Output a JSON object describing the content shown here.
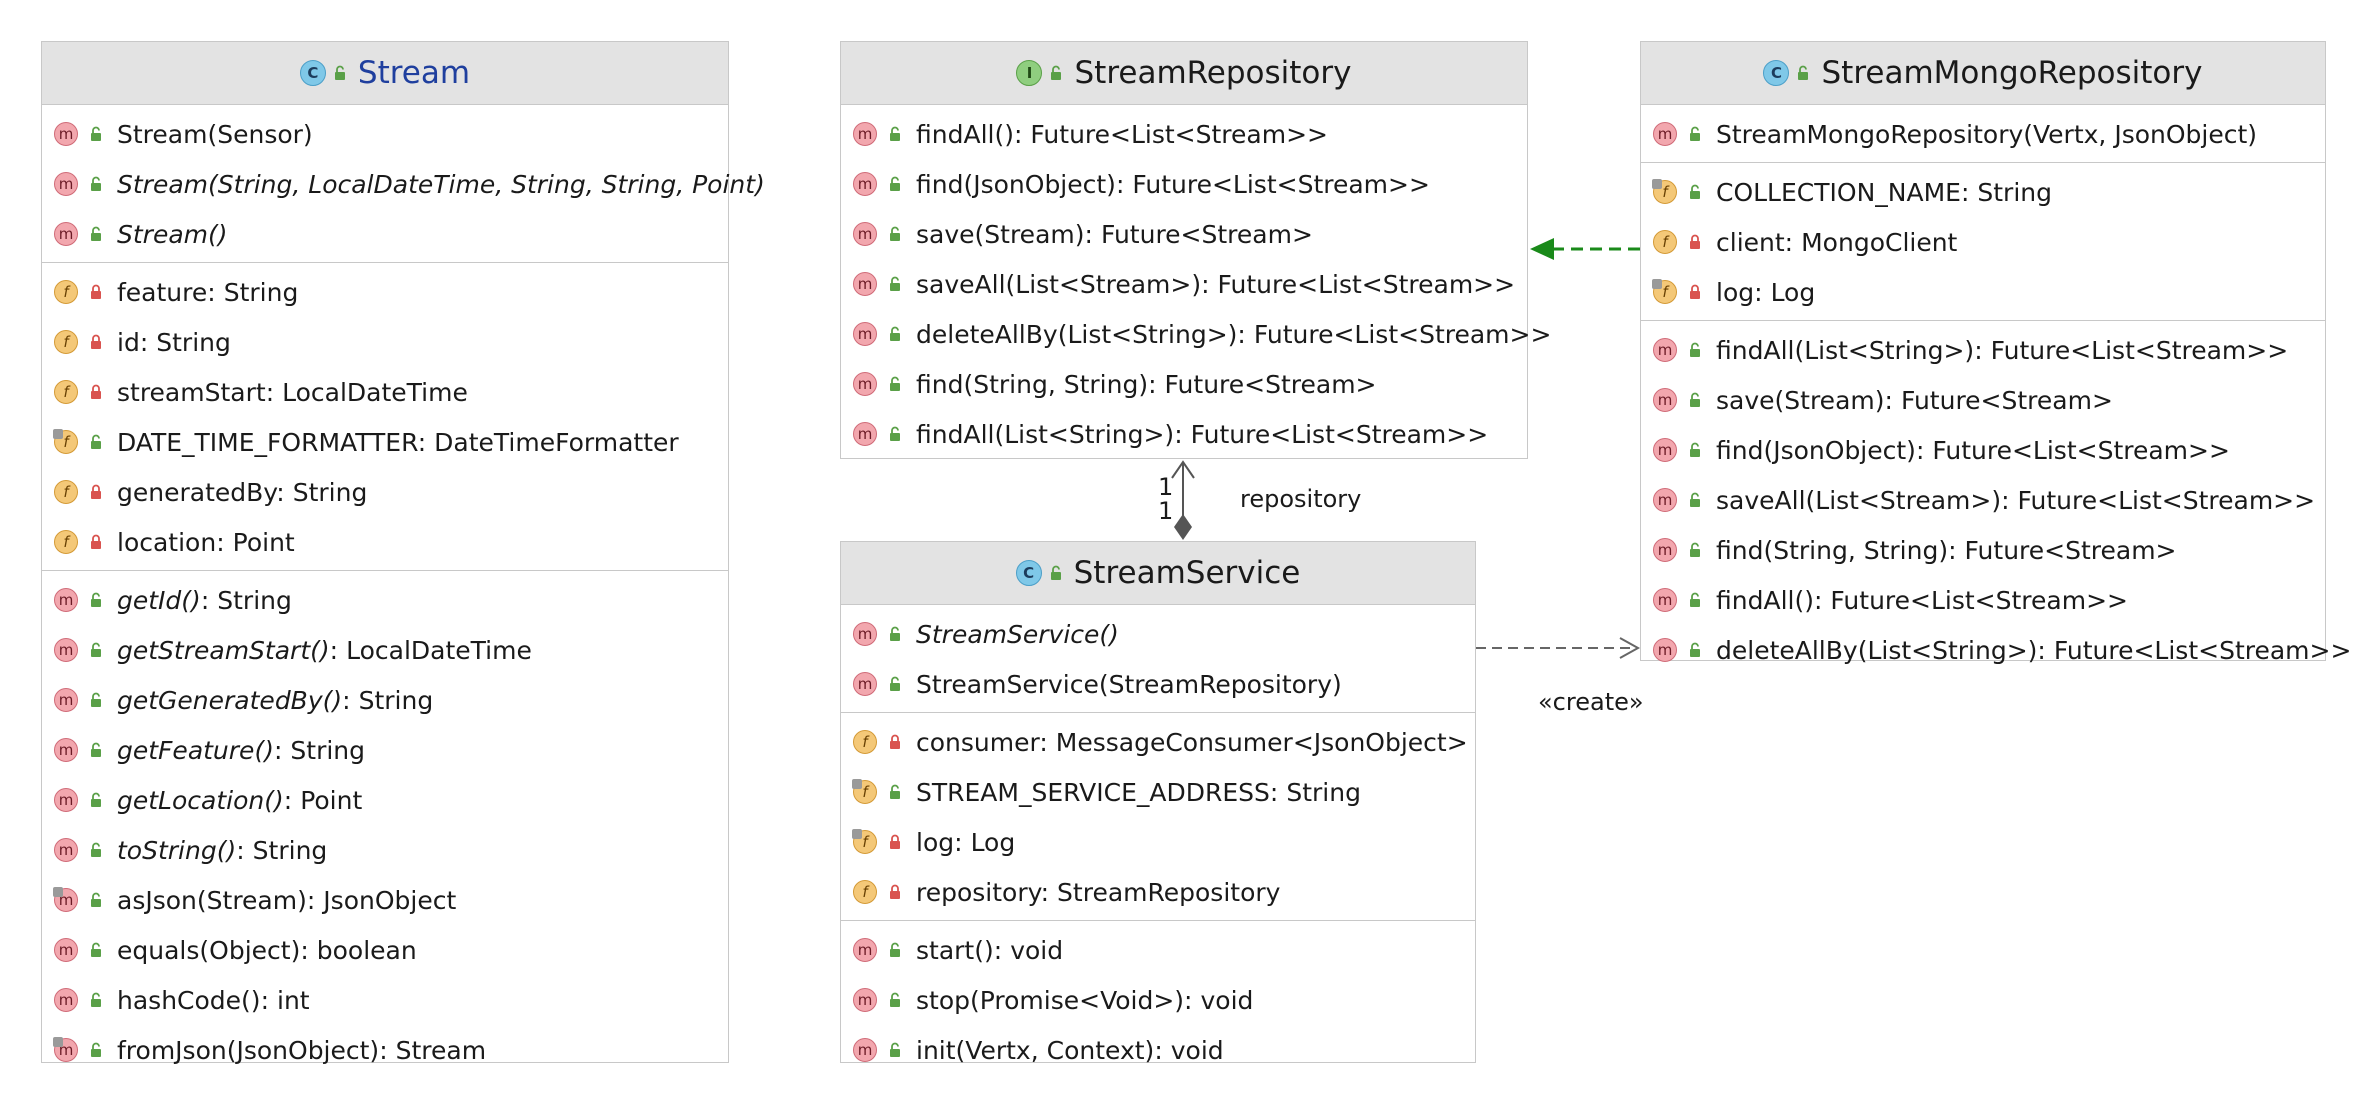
{
  "colors": {
    "header_bg": "#e3e3e3",
    "border": "#c8c8c8",
    "stream_title": "#1f3f9e",
    "implements_arrow": "#1a8a1a",
    "dependency_arrow": "#666666",
    "composition": "#555555"
  },
  "classes": {
    "stream": {
      "kind_icon": "C",
      "title": "Stream",
      "constructors": [
        {
          "name": "Stream",
          "params": "(Sensor)",
          "ret": "",
          "italic": false
        },
        {
          "name": "Stream",
          "params": "(String, LocalDateTime, String, String, Point)",
          "ret": "",
          "italic": true
        },
        {
          "name": "Stream",
          "params": "()",
          "ret": "",
          "italic": true
        }
      ],
      "fields": [
        {
          "name": "feature",
          "type": "String",
          "private": true,
          "static": false
        },
        {
          "name": "id",
          "type": "String",
          "private": true,
          "static": false
        },
        {
          "name": "streamStart",
          "type": "LocalDateTime",
          "private": true,
          "static": false
        },
        {
          "name": "DATE_TIME_FORMATTER",
          "type": "DateTimeFormatter",
          "private": false,
          "static": true
        },
        {
          "name": "generatedBy",
          "type": "String",
          "private": true,
          "static": false
        },
        {
          "name": "location",
          "type": "Point",
          "private": true,
          "static": false
        }
      ],
      "methods": [
        {
          "name": "getId",
          "params": "()",
          "ret": "String",
          "italic": true
        },
        {
          "name": "getStreamStart",
          "params": "()",
          "ret": "LocalDateTime",
          "italic": true
        },
        {
          "name": "getGeneratedBy",
          "params": "()",
          "ret": "String",
          "italic": true
        },
        {
          "name": "getFeature",
          "params": "()",
          "ret": "String",
          "italic": true
        },
        {
          "name": "getLocation",
          "params": "()",
          "ret": "Point",
          "italic": true
        },
        {
          "name": "toString",
          "params": "()",
          "ret": "String",
          "italic": true
        },
        {
          "name": "asJson",
          "params": "(Stream)",
          "ret": "JsonObject",
          "italic": false,
          "static": true
        },
        {
          "name": "equals",
          "params": "(Object)",
          "ret": "boolean",
          "italic": false
        },
        {
          "name": "hashCode",
          "params": "()",
          "ret": "int",
          "italic": false
        },
        {
          "name": "fromJson",
          "params": "(JsonObject)",
          "ret": "Stream",
          "italic": false,
          "static": true
        }
      ]
    },
    "stream_repository": {
      "kind_icon": "I",
      "title": "StreamRepository",
      "methods": [
        {
          "name": "findAll",
          "params": "()",
          "ret": "Future<List<Stream>>"
        },
        {
          "name": "find",
          "params": "(JsonObject)",
          "ret": "Future<List<Stream>>"
        },
        {
          "name": "save",
          "params": "(Stream)",
          "ret": "Future<Stream>"
        },
        {
          "name": "saveAll",
          "params": "(List<Stream>)",
          "ret": "Future<List<Stream>>"
        },
        {
          "name": "deleteAllBy",
          "params": "(List<String>)",
          "ret": "Future<List<Stream>>"
        },
        {
          "name": "find",
          "params": "(String, String)",
          "ret": "Future<Stream>"
        },
        {
          "name": "findAll",
          "params": "(List<String>)",
          "ret": "Future<List<Stream>>"
        }
      ]
    },
    "stream_mongo_repository": {
      "kind_icon": "C",
      "title": "StreamMongoRepository",
      "constructors": [
        {
          "name": "StreamMongoRepository",
          "params": "(Vertx, JsonObject)",
          "ret": ""
        }
      ],
      "fields": [
        {
          "name": "COLLECTION_NAME",
          "type": "String",
          "private": false,
          "static": true
        },
        {
          "name": "client",
          "type": "MongoClient",
          "private": true,
          "static": false
        },
        {
          "name": "log",
          "type": "Log",
          "private": true,
          "static": true
        }
      ],
      "methods": [
        {
          "name": "findAll",
          "params": "(List<String>)",
          "ret": "Future<List<Stream>>"
        },
        {
          "name": "save",
          "params": "(Stream)",
          "ret": "Future<Stream>"
        },
        {
          "name": "find",
          "params": "(JsonObject)",
          "ret": "Future<List<Stream>>"
        },
        {
          "name": "saveAll",
          "params": "(List<Stream>)",
          "ret": "Future<List<Stream>>"
        },
        {
          "name": "find",
          "params": "(String, String)",
          "ret": "Future<Stream>"
        },
        {
          "name": "findAll",
          "params": "()",
          "ret": "Future<List<Stream>>"
        },
        {
          "name": "deleteAllBy",
          "params": "(List<String>)",
          "ret": "Future<List<Stream>>"
        }
      ]
    },
    "stream_service": {
      "kind_icon": "C",
      "title": "StreamService",
      "constructors": [
        {
          "name": "StreamService",
          "params": "()",
          "ret": "",
          "italic": true
        },
        {
          "name": "StreamService",
          "params": "(StreamRepository)",
          "ret": "",
          "italic": false
        }
      ],
      "fields": [
        {
          "name": "consumer",
          "type": "MessageConsumer<JsonObject>",
          "private": true,
          "static": false
        },
        {
          "name": "STREAM_SERVICE_ADDRESS",
          "type": "String",
          "private": false,
          "static": true
        },
        {
          "name": "log",
          "type": "Log",
          "private": true,
          "static": true
        },
        {
          "name": "repository",
          "type": "StreamRepository",
          "private": true,
          "static": false
        }
      ],
      "methods": [
        {
          "name": "start",
          "params": "()",
          "ret": "void"
        },
        {
          "name": "stop",
          "params": "(Promise<Void>)",
          "ret": "void"
        },
        {
          "name": "init",
          "params": "(Vertx, Context)",
          "ret": "void"
        }
      ]
    }
  },
  "relations": {
    "composition_label": "repository",
    "multiplicity_source": "1",
    "multiplicity_target": "1",
    "dependency_label": "«create»"
  }
}
